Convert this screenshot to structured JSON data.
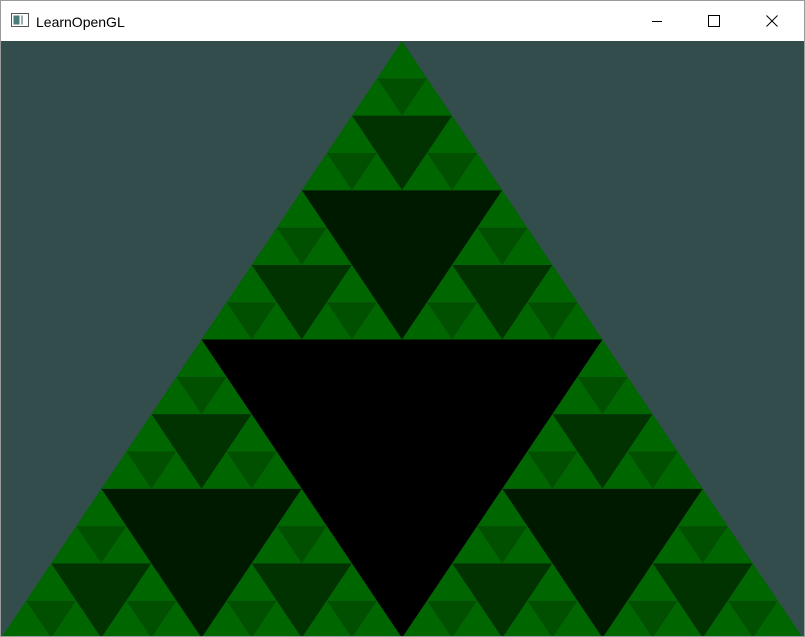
{
  "window": {
    "title": "LearnOpenGL",
    "controls": {
      "minimize_icon": "minimize-icon",
      "maximize_icon": "maximize-icon",
      "close_icon": "close-icon"
    }
  },
  "scene": {
    "description_icon": "sierpinski-triangle",
    "clear_color": "#334d4d",
    "depth_colors": [
      "#000000",
      "#001a00",
      "#003300",
      "#005000",
      "#006600"
    ],
    "recursion_levels": 4
  }
}
